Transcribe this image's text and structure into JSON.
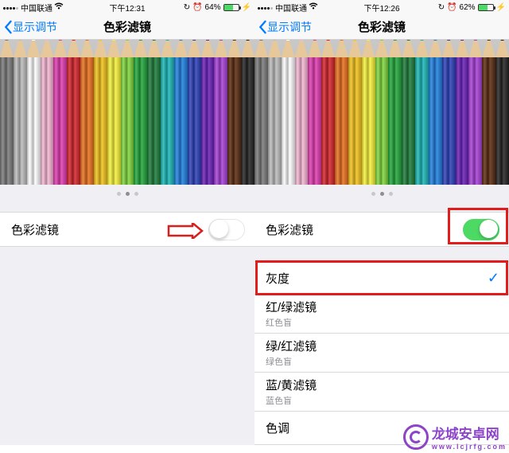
{
  "left": {
    "status": {
      "carrier": "中国联通",
      "time": "下午12:31",
      "battery_pct": "64%"
    },
    "nav": {
      "back": "显示调节",
      "title": "色彩滤镜"
    },
    "toggle": {
      "label": "色彩滤镜",
      "on": false
    }
  },
  "right": {
    "status": {
      "carrier": "中国联通",
      "time": "下午12:26",
      "battery_pct": "62%"
    },
    "nav": {
      "back": "显示调节",
      "title": "色彩滤镜"
    },
    "toggle": {
      "label": "色彩滤镜",
      "on": true
    },
    "options": [
      {
        "label": "灰度",
        "sub": null,
        "selected": true
      },
      {
        "label": "红/绿滤镜",
        "sub": "红色盲",
        "selected": false
      },
      {
        "label": "绿/红滤镜",
        "sub": "绿色盲",
        "selected": false
      },
      {
        "label": "蓝/黄滤镜",
        "sub": "蓝色盲",
        "selected": false
      },
      {
        "label": "色调",
        "sub": null,
        "selected": false
      }
    ]
  },
  "pencil_colors": [
    "#7a7a7a",
    "#bcbcbc",
    "#ffffff",
    "#f5b7d4",
    "#e23ab0",
    "#d4232a",
    "#e86f1c",
    "#f2c21b",
    "#f8f23a",
    "#7fd63d",
    "#21a63a",
    "#1c7b3a",
    "#1ab6b6",
    "#1f7fe0",
    "#2b3fb8",
    "#6a1fb8",
    "#a63fd6",
    "#5a2a0e",
    "#222"
  ],
  "watermark": {
    "name": "龙城安卓网",
    "url": "www.lcjrfg.com"
  }
}
